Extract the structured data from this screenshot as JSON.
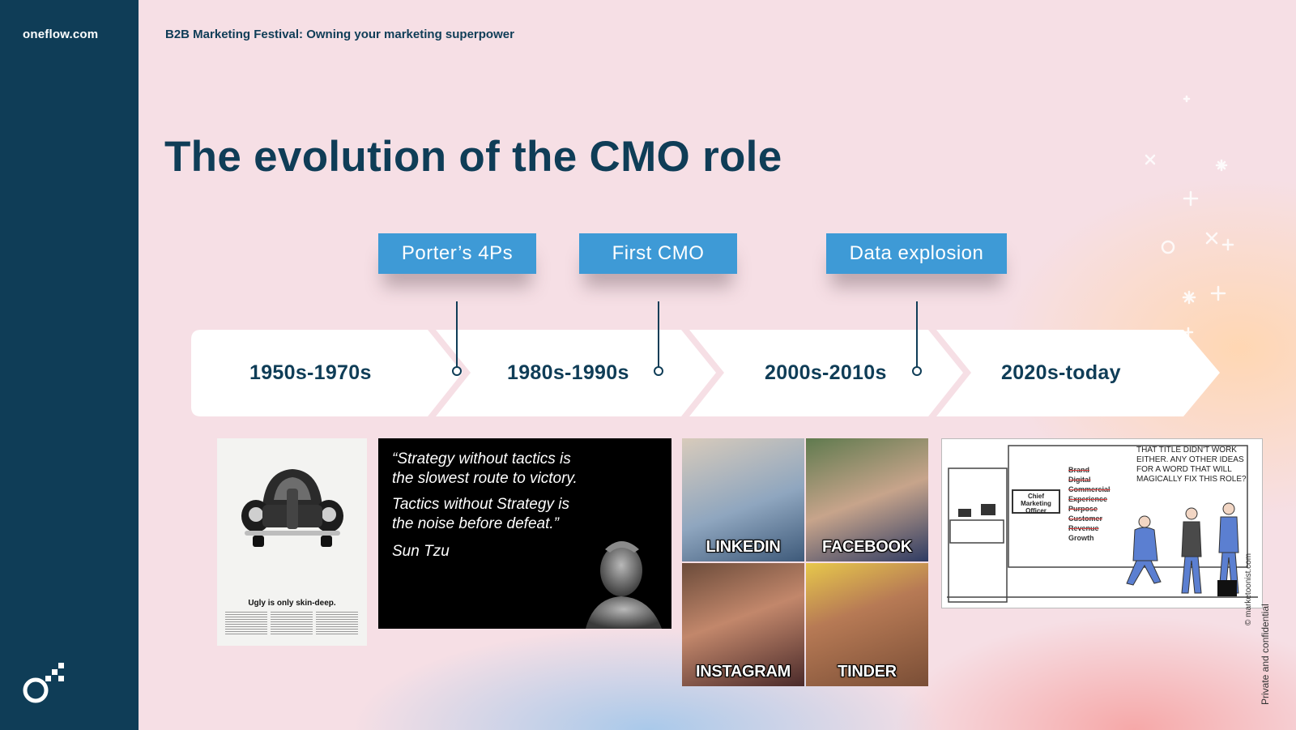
{
  "sidebar": {
    "brand": "oneflow.com",
    "logo_icon": "oneflow-logo-icon"
  },
  "header": {
    "event_title": "B2B Marketing Festival: Owning your marketing superpower"
  },
  "slide": {
    "title": "The evolution of the CMO role"
  },
  "milestones": [
    {
      "label": "Porter’s 4Ps"
    },
    {
      "label": "First CMO"
    },
    {
      "label": "Data explosion"
    }
  ],
  "eras": [
    {
      "label": "1950s-1970s"
    },
    {
      "label": "1980s-1990s"
    },
    {
      "label": "2000s-2010s"
    },
    {
      "label": "2020s-today"
    }
  ],
  "images": {
    "vw_ad": {
      "headline": "Ugly is only skin-deep."
    },
    "quote": {
      "line1": "“Strategy without tactics is",
      "line2": "the slowest route to victory.",
      "line3": "Tactics without Strategy is",
      "line4": "the noise before defeat.”",
      "author": "Sun Tzu"
    },
    "meme": {
      "tiles": [
        {
          "label": "LINKEDIN"
        },
        {
          "label": "FACEBOOK"
        },
        {
          "label": "INSTAGRAM"
        },
        {
          "label": "TINDER"
        }
      ]
    },
    "cartoon": {
      "caption": "That title didn't work either. Any other ideas for a word that will magically fix this role?",
      "sign": "Chief Marketing Officer",
      "words": [
        "Brand",
        "Digital",
        "Commercial",
        "Experience",
        "Purpose",
        "Customer",
        "Revenue",
        "Growth"
      ],
      "credit": "© marketoonist.com"
    }
  },
  "footer": {
    "confidential": "Private and confidential"
  },
  "colors": {
    "navy": "#0f3d57",
    "accent_blue": "#3e9ad6",
    "background_pink": "#f6dfe5"
  }
}
